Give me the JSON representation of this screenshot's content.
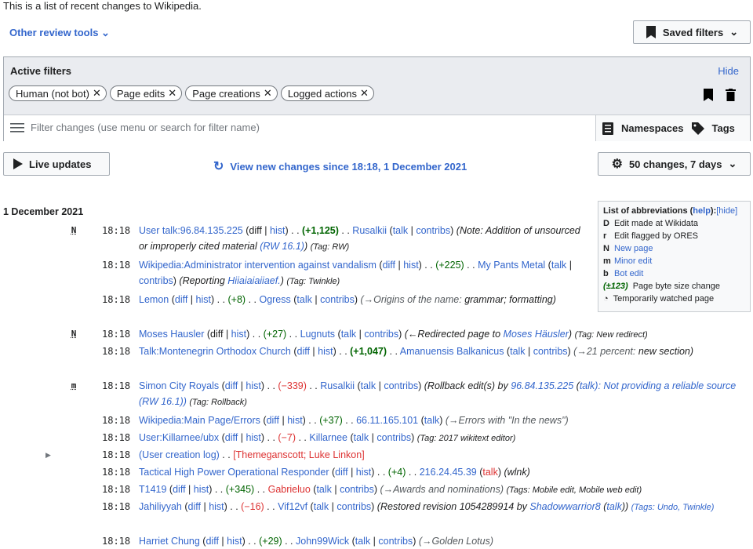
{
  "intro": "This is a list of recent changes to Wikipedia.",
  "review_tools": "Other review tools",
  "saved_filters": "Saved filters",
  "active_filters": {
    "title": "Active filters",
    "hide": "Hide",
    "chips": [
      "Human (not bot)",
      "Page edits",
      "Page creations",
      "Logged actions"
    ]
  },
  "filter_input_placeholder": "Filter changes (use menu or search for filter name)",
  "namespaces": "Namespaces",
  "tags": "Tags",
  "live_updates": "Live updates",
  "view_new": "View new changes since 18:18, 1 December 2021",
  "changes_btn": "50 changes, 7 days",
  "legend": {
    "title": "List of abbreviations (",
    "help": "help",
    "title_end": "):",
    "hide": "[hide]",
    "d_text": "Edit made at Wikidata",
    "r_text": "Edit flagged by ORES",
    "n_text": "New page",
    "m_text": "Minor edit",
    "b_text": "Bot edit",
    "size_key": "(±123)",
    "size_text": "Page byte size change",
    "watch_text": "Temporarily watched page"
  },
  "date": "1 December 2021",
  "entries": {
    "e1": {
      "flag": "N",
      "time": "18:18",
      "page": "User talk:96.84.135.225",
      "diff": "diff",
      "hist": "hist",
      "size": "(+1,125)",
      "user": "Rusalkii",
      "talk": "talk",
      "contribs": "contribs",
      "summary": "(Note: Addition of unsourced or improperly cited material",
      "summary_link": "(RW 16.1)",
      "summary_end": ")",
      "tag": "(Tag: RW)"
    },
    "e2": {
      "time": "18:18",
      "page": "Wikipedia:Administrator intervention against vandalism",
      "diff": "diff",
      "hist": "hist",
      "size": "(+225)",
      "user": "My Pants Metal",
      "talk": "talk",
      "contribs": "contribs",
      "summary": "(Reporting",
      "summary_link": "Hiiaiaiaiiaef.",
      "summary_end": ")",
      "tag": "(Tag: Twinkle)"
    },
    "e3": {
      "time": "18:18",
      "page": "Lemon",
      "diff": "diff",
      "hist": "hist",
      "size": "(+8)",
      "user": "Ogress",
      "talk": "talk",
      "contribs": "contribs",
      "summary": "(→Origins of the name:",
      "summary_plain": "grammar; formatting)"
    },
    "e4": {
      "flag": "N",
      "time": "18:18",
      "page": "Moses Hausler",
      "diff": "diff",
      "hist": "hist",
      "size": "(+27)",
      "user": "Lugnuts",
      "talk": "talk",
      "contribs": "contribs",
      "summary": "(←Redirected page to",
      "summary_link": "Moses Häusler",
      "summary_end": ")",
      "tag": "(Tag: New redirect)"
    },
    "e5": {
      "time": "18:18",
      "page": "Talk:Montenegrin Orthodox Church",
      "diff": "diff",
      "hist": "hist",
      "size": "(+1,047)",
      "user": "Amanuensis Balkanicus",
      "talk": "talk",
      "contribs": "contribs",
      "summary": "(→21 percent:",
      "summary_plain": "new section)"
    },
    "e6": {
      "flag": "m",
      "time": "18:18",
      "page": "Simon City Royals",
      "diff": "diff",
      "hist": "hist",
      "size": "(−339)",
      "user": "Rusalkii",
      "talk": "talk",
      "contribs": "contribs",
      "summary": "(Rollback edit(s) by",
      "summary_link": "96.84.135.225",
      "summary_link2": "talk",
      "summary_end": "): Not providing a reliable source (RW 16.1))",
      "tag": "(Tag: Rollback)"
    },
    "e7": {
      "time": "18:18",
      "page": "Wikipedia:Main Page/Errors",
      "diff": "diff",
      "hist": "hist",
      "size": "(+37)",
      "user": "66.11.165.101",
      "talk": "talk",
      "summary": "(→Errors with \"In the news\")"
    },
    "e8": {
      "time": "18:18",
      "page": "User:Killarnee/ubx",
      "diff": "diff",
      "hist": "hist",
      "size": "(−7)",
      "user": "Killarnee",
      "talk": "talk",
      "contribs": "contribs",
      "tag": "(Tag: 2017 wikitext editor)"
    },
    "e9": {
      "time": "18:18",
      "page": "(User creation log)",
      "users": "[Themeganscott; Luke Linkon]"
    },
    "e10": {
      "time": "18:18",
      "page": "Tactical High Power Operational Responder",
      "diff": "diff",
      "hist": "hist",
      "size": "(+4)",
      "user": "216.24.45.39",
      "talk": "talk",
      "summary": "(wlnk)"
    },
    "e11": {
      "time": "18:18",
      "page": "T1419",
      "diff": "diff",
      "hist": "hist",
      "size": "(+345)",
      "user": "Gabrieluo",
      "talk": "talk",
      "contribs": "contribs",
      "summary": "(→Awards and nominations)",
      "tag": "(Tags: Mobile edit, Mobile web edit)"
    },
    "e12": {
      "time": "18:18",
      "page": "Jahiliyyah",
      "diff": "diff",
      "hist": "hist",
      "size": "(−16)",
      "user": "Vif12vf",
      "talk": "talk",
      "contribs": "contribs",
      "summary": "(Restored revision 1054289914 by",
      "summary_link": "Shadowwarrior8",
      "summary_link2": "talk",
      "summary_end": "))",
      "tag": "(Tags: Undo, Twinkle)"
    },
    "e13": {
      "time": "18:18",
      "page": "Harriet Chung",
      "diff": "diff",
      "hist": "hist",
      "size": "(+29)",
      "user": "John99Wick",
      "talk": "talk",
      "contribs": "contribs",
      "summary": "(→Golden Lotus)"
    }
  }
}
